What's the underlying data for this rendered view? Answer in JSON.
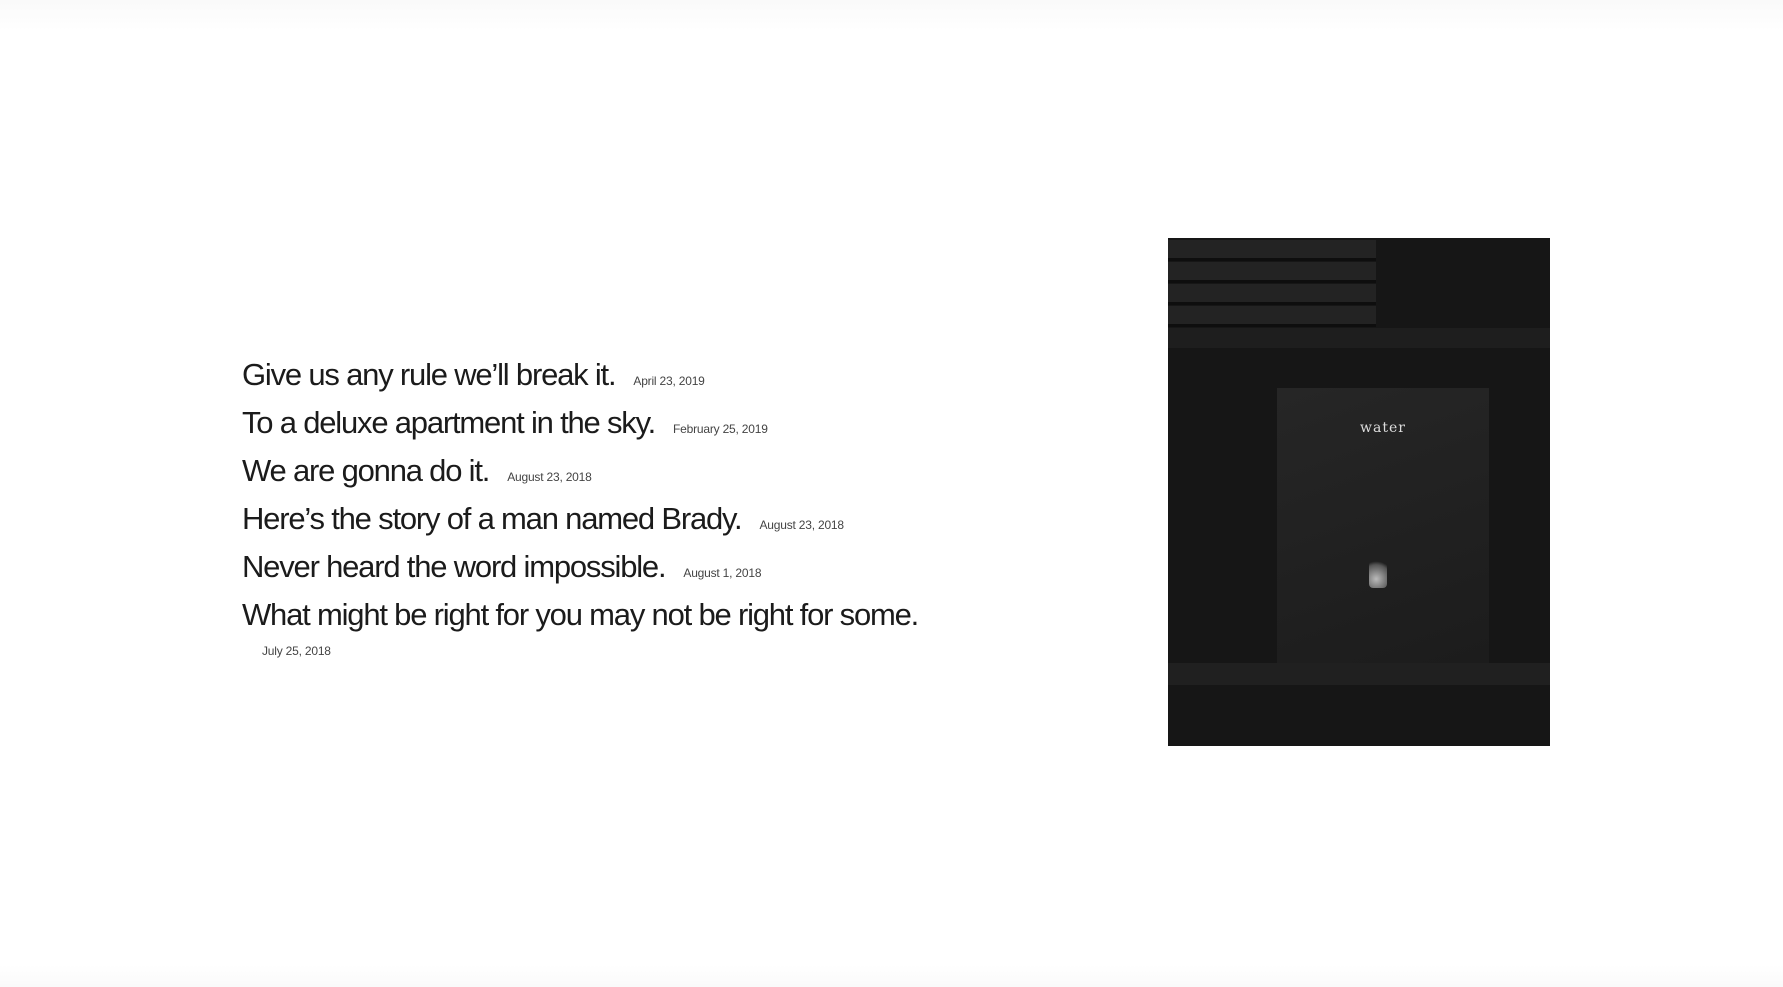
{
  "posts": [
    {
      "title": "Give us any rule we’ll break it.",
      "date": "April 23, 2019"
    },
    {
      "title": "To a deluxe apartment in the sky.",
      "date": "February 25, 2019"
    },
    {
      "title": "We are gonna do it.",
      "date": "August 23, 2018"
    },
    {
      "title": "Here’s the story of a man named Brady.",
      "date": "August 23, 2018"
    },
    {
      "title": "Never heard the word impossible.",
      "date": "August 1, 2018"
    },
    {
      "title": "What might be right for you may not be right for some.",
      "date": "July 25, 2018"
    }
  ],
  "featured_image": {
    "cover_text": "water"
  }
}
